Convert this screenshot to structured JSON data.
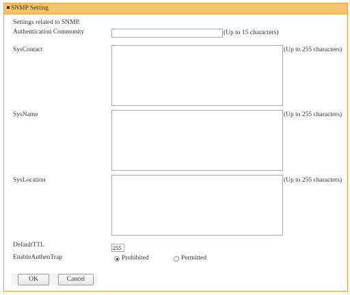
{
  "panel": {
    "title": "SNMP Setting"
  },
  "form": {
    "intro": "Settings related to SNMP.",
    "auth_community": {
      "label": "Authentication Community",
      "value": "",
      "hint": "(Up to 15 characters)"
    },
    "sys_contact": {
      "label": "SysContact",
      "value": "",
      "hint": "(Up to 255 characters)"
    },
    "sys_name": {
      "label": "SysName",
      "value": "",
      "hint": "(Up to 255 characters)"
    },
    "sys_location": {
      "label": "SysLocation",
      "value": "",
      "hint": "(Up to 255 characters)"
    },
    "default_ttl": {
      "label": "DefaultTTL",
      "value": "255"
    },
    "enable_authen_trap": {
      "label": "EnableAuthenTrap",
      "options": [
        {
          "label": "Prohibited",
          "selected": true
        },
        {
          "label": "Permitted",
          "selected": false
        }
      ]
    }
  },
  "buttons": {
    "ok": "OK",
    "cancel": "Cancel"
  }
}
